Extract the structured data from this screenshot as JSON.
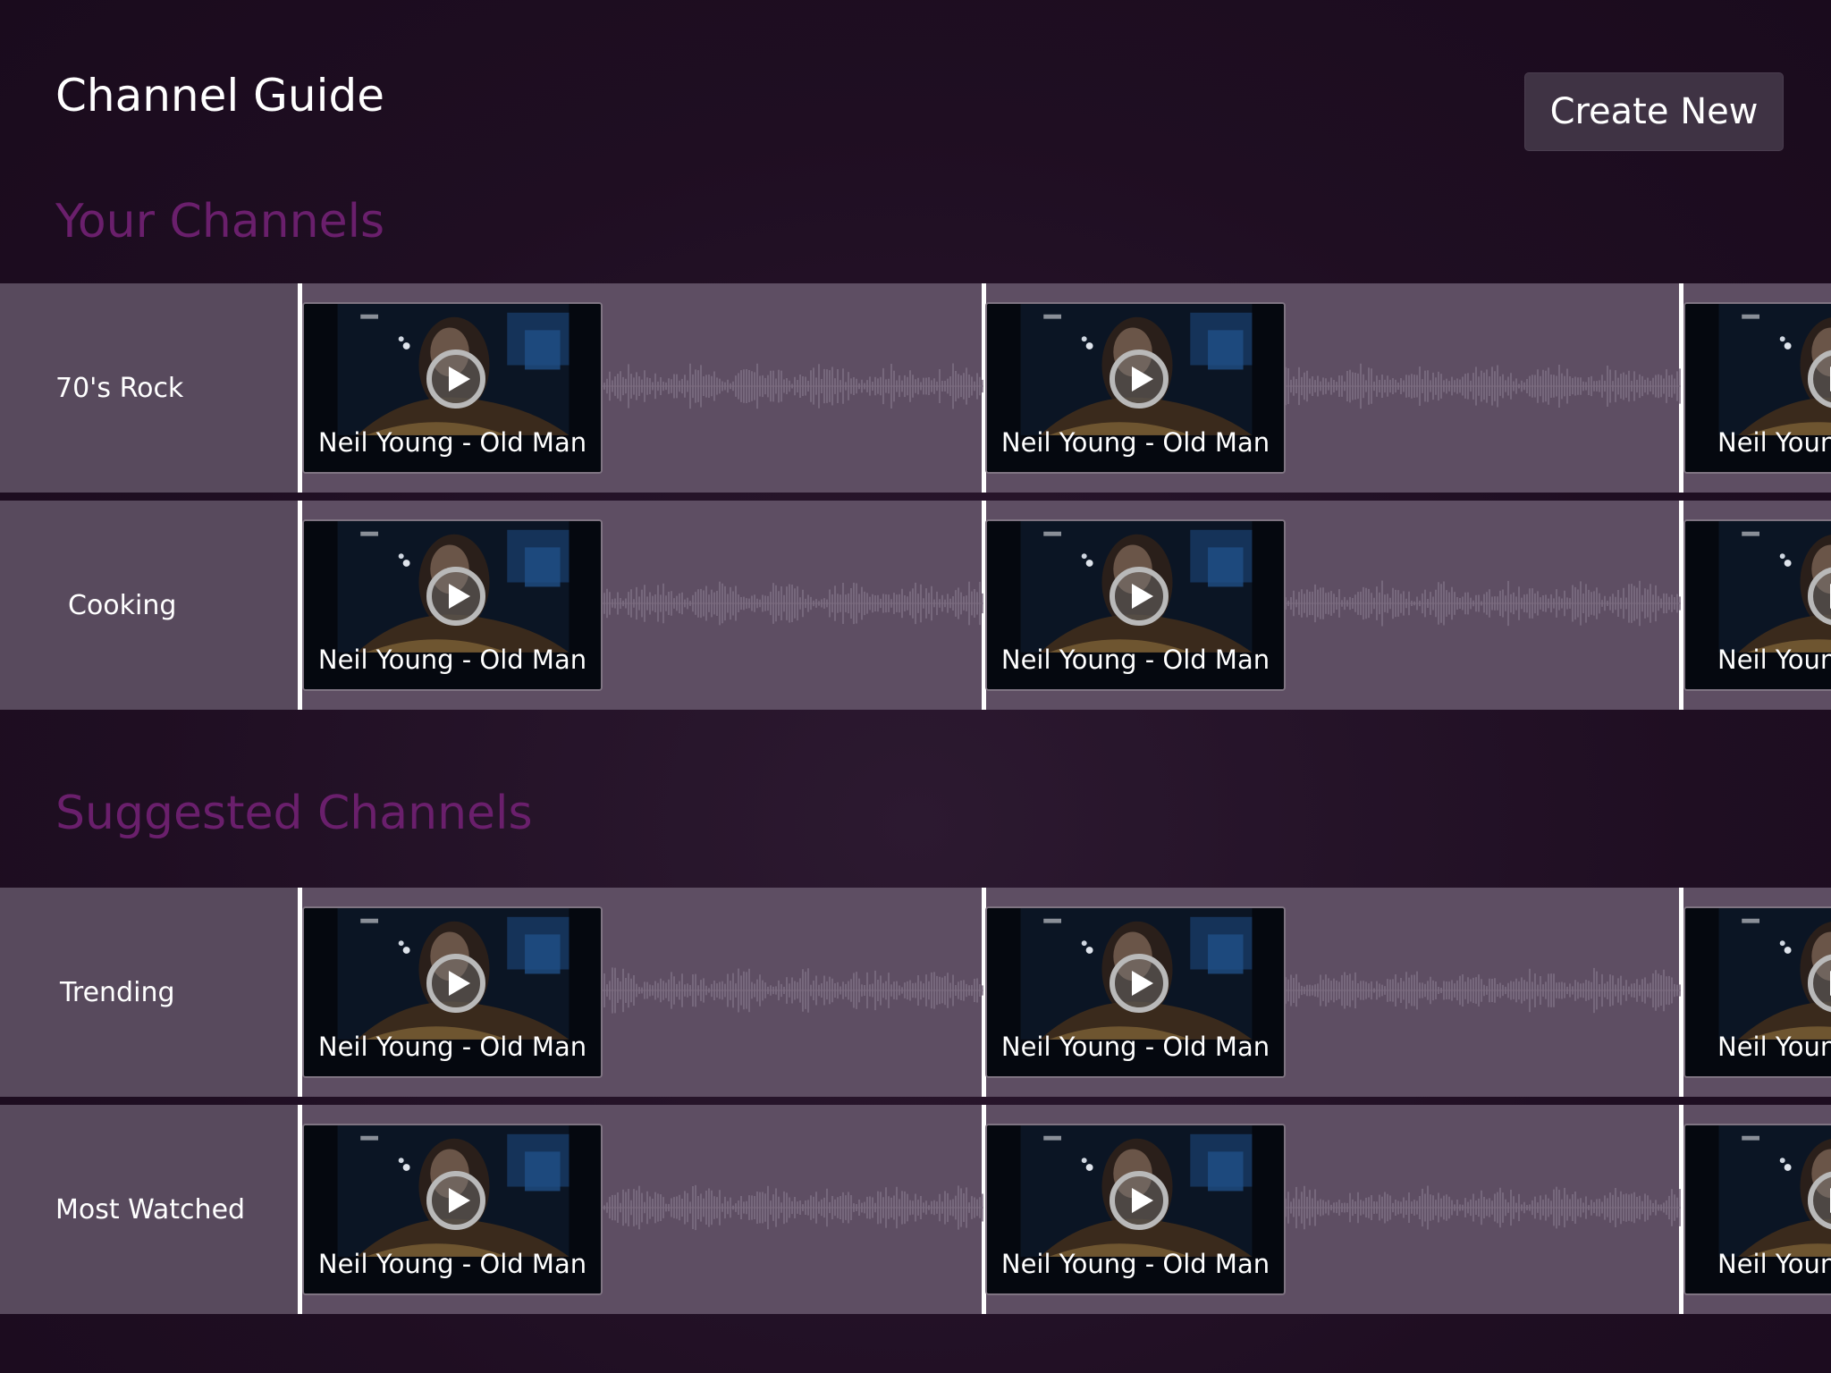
{
  "header": {
    "title": "Channel Guide",
    "create_label": "Create New"
  },
  "sections": [
    {
      "title": "Your Channels",
      "rows": [
        {
          "label": "70's Rock",
          "videos": [
            "Neil Young - Old Man",
            "Neil Young - Old Man",
            "Neil Young - Old Man"
          ]
        },
        {
          "label": "Cooking",
          "videos": [
            "Neil Young - Old Man",
            "Neil Young - Old Man",
            "Neil Young - Old Man"
          ]
        }
      ]
    },
    {
      "title": "Suggested Channels",
      "rows": [
        {
          "label": "Trending",
          "videos": [
            "Neil Young - Old Man",
            "Neil Young - Old Man",
            "Neil Young - Old Man"
          ]
        },
        {
          "label": "Most Watched",
          "videos": [
            "Neil Young - Old Man",
            "Neil Young - Old Man",
            "Neil Young - Old Man"
          ]
        }
      ]
    }
  ],
  "icons": {
    "play": "play-icon"
  },
  "colors": {
    "background": "#1f0e22",
    "section_title": "#6a1f6c",
    "row_bg": "#5b4a60",
    "button_bg": "#3f3344"
  }
}
